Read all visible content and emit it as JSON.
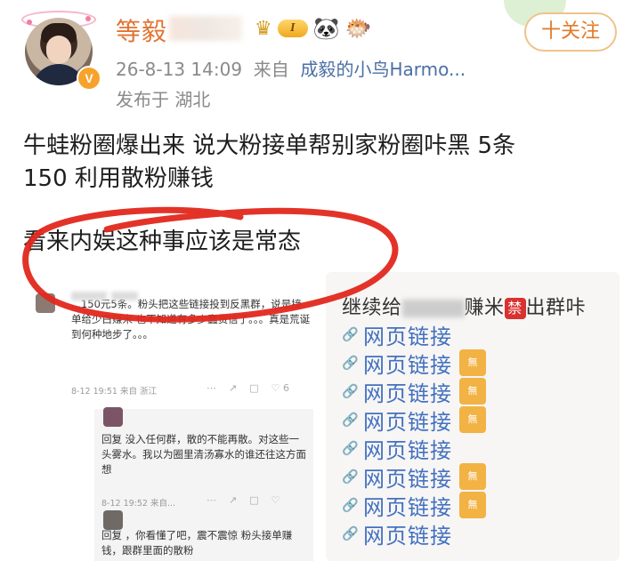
{
  "header": {
    "author_name": "等毅",
    "level_badge": "I",
    "verified_badge": "V",
    "follow_button": "十关注",
    "timestamp": "26-8-13 14:09",
    "source_prefix": "来自",
    "source_name": "成毅的小鸟Harmo...",
    "location": "发布于 湖北"
  },
  "post": {
    "line1": "牛蛙粉圈爆出来  说大粉接单帮别家粉圈咔黑   5条",
    "line2": "150  利用散粉赚钱",
    "line3": "看来内娱这种事应该是常态"
  },
  "left_image": {
    "comment1": {
      "text": "...150元5条。粉头把这些链接投到反黑群，说是接单给少白赚米 也不知道有多少蠢货信了。。。真是荒诞到何种地步了。。。",
      "meta": "8-12 19:51 来自 浙江",
      "likes": "6"
    },
    "reply1": {
      "text": "回复      没入任何群，散的不能再散。对这些一头雾水。我以为圈里清汤寡水的谁还往这方面想",
      "meta": "8-12 19:52 来自..."
    },
    "reply2": {
      "text": "回复      ，你看懂了吧，震不震惊 粉头接单赚钱，跟群里面的散粉"
    }
  },
  "right_image": {
    "title_prefix": "继续给",
    "title_mid": "赚米",
    "ban_badge": "禁",
    "title_suffix": "出群咔",
    "links": [
      {
        "label": "网页链接",
        "badge": ""
      },
      {
        "label": "网页链接",
        "badge": "無"
      },
      {
        "label": "网页链接",
        "badge": "無"
      },
      {
        "label": "网页链接",
        "badge": "無"
      },
      {
        "label": "网页链接",
        "badge": ""
      },
      {
        "label": "网页链接",
        "badge": "無"
      },
      {
        "label": "网页链接",
        "badge": "無"
      },
      {
        "label": "网页链接",
        "badge": ""
      }
    ]
  },
  "colors": {
    "name": "#e07432",
    "link": "#4471c0",
    "annotation_circle": "#e2281e",
    "follow_border": "#f0c28a"
  }
}
